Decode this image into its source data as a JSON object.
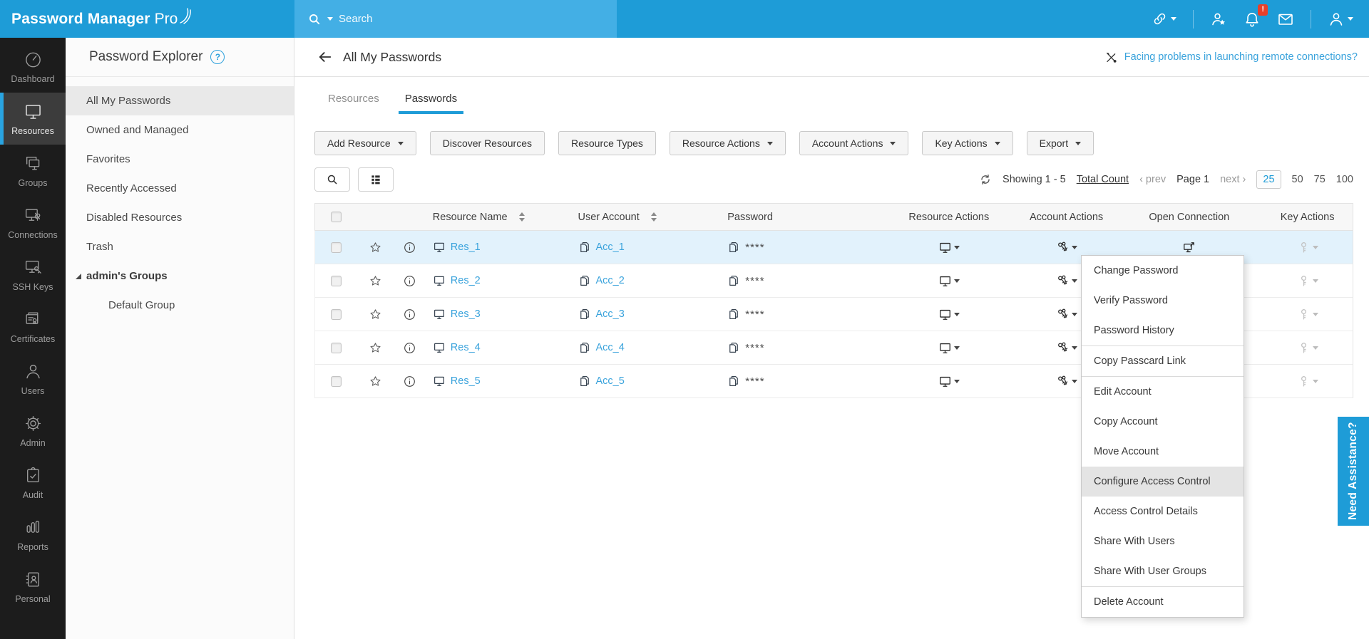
{
  "brand": {
    "name_bold": "Password Manager",
    "name_light": "Pro"
  },
  "topbar": {
    "search_placeholder": "Search",
    "badge": "!",
    "icons": [
      "connection-link-icon",
      "user-star-icon",
      "notification-bell-icon",
      "mail-icon",
      "profile-icon"
    ]
  },
  "nav": {
    "items": [
      {
        "label": "Dashboard",
        "icon": "dashboard-icon",
        "active": false
      },
      {
        "label": "Resources",
        "icon": "resources-icon",
        "active": true
      },
      {
        "label": "Groups",
        "icon": "groups-icon",
        "active": false
      },
      {
        "label": "Connections",
        "icon": "connections-icon",
        "active": false
      },
      {
        "label": "SSH Keys",
        "icon": "ssh-keys-icon",
        "active": false
      },
      {
        "label": "Certificates",
        "icon": "certificates-icon",
        "active": false
      },
      {
        "label": "Users",
        "icon": "users-icon",
        "active": false
      },
      {
        "label": "Admin",
        "icon": "admin-gear-icon",
        "active": false
      },
      {
        "label": "Audit",
        "icon": "audit-icon",
        "active": false
      },
      {
        "label": "Reports",
        "icon": "reports-icon",
        "active": false
      },
      {
        "label": "Personal",
        "icon": "personal-icon",
        "active": false
      }
    ]
  },
  "explorer": {
    "title": "Password Explorer",
    "help_icon": "help-icon",
    "items": [
      {
        "label": "All My Passwords",
        "active": true
      },
      {
        "label": "Owned and Managed",
        "active": false
      },
      {
        "label": "Favorites",
        "active": false
      },
      {
        "label": "Recently Accessed",
        "active": false
      },
      {
        "label": "Disabled Resources",
        "active": false
      },
      {
        "label": "Trash",
        "active": false
      }
    ],
    "tree": [
      {
        "label": "admin's Groups",
        "expanded": true
      },
      {
        "label": "Default Group",
        "child": true
      }
    ]
  },
  "page": {
    "title": "All My Passwords",
    "help_link": "Facing problems in launching remote connections?"
  },
  "tabs": [
    {
      "label": "Resources",
      "active": false
    },
    {
      "label": "Passwords",
      "active": true
    }
  ],
  "toolbar": [
    {
      "label": "Add Resource",
      "dropdown": true
    },
    {
      "label": "Discover Resources",
      "dropdown": false
    },
    {
      "label": "Resource Types",
      "dropdown": false
    },
    {
      "label": "Resource Actions",
      "dropdown": true
    },
    {
      "label": "Account Actions",
      "dropdown": true
    },
    {
      "label": "Key Actions",
      "dropdown": true
    },
    {
      "label": "Export",
      "dropdown": true
    }
  ],
  "view_icons": [
    "search-icon",
    "list-view-icon"
  ],
  "pagination": {
    "refresh_icon": "refresh-icon",
    "showing": "Showing 1 - 5",
    "total_count": "Total Count",
    "prev": "‹ prev",
    "page": "Page 1",
    "next": "next ›",
    "sizes": [
      "25",
      "50",
      "75",
      "100"
    ],
    "selected_size": "25"
  },
  "table": {
    "columns": [
      "Resource Name",
      "User Account",
      "Password",
      "Resource Actions",
      "Account Actions",
      "Open Connection",
      "Key Actions"
    ],
    "password_mask": "****",
    "rows": [
      {
        "resource": "Res_1",
        "account": "Acc_1",
        "selected": true
      },
      {
        "resource": "Res_2",
        "account": "Acc_2",
        "selected": false
      },
      {
        "resource": "Res_3",
        "account": "Acc_3",
        "selected": false
      },
      {
        "resource": "Res_4",
        "account": "Acc_4",
        "selected": false
      },
      {
        "resource": "Res_5",
        "account": "Acc_5",
        "selected": false
      }
    ]
  },
  "context_menu": {
    "items": [
      {
        "label": "Change Password",
        "highlighted": false
      },
      {
        "label": "Verify Password",
        "highlighted": false
      },
      {
        "label": "Password History",
        "highlighted": false,
        "divider_after": true
      },
      {
        "label": "Copy Passcard Link",
        "highlighted": false,
        "divider_after": true
      },
      {
        "label": "Edit Account",
        "highlighted": false
      },
      {
        "label": "Copy Account",
        "highlighted": false
      },
      {
        "label": "Move Account",
        "highlighted": false
      },
      {
        "label": "Configure Access Control",
        "highlighted": true
      },
      {
        "label": "Access Control Details",
        "highlighted": false
      },
      {
        "label": "Share With Users",
        "highlighted": false
      },
      {
        "label": "Share With User Groups",
        "highlighted": false,
        "divider_after": true
      },
      {
        "label": "Delete Account",
        "highlighted": false
      }
    ]
  },
  "assistance_tab": "Need Assistance?",
  "colors": {
    "header_blue": "#1e9cd7",
    "search_strip_blue": "#43afe5",
    "link_blue": "#3aa3dc",
    "badge_red": "#e8402a",
    "row_highlight": "#e2f2fc",
    "rail_dark": "#1c1c1c",
    "menu_highlight": "#e4e4e4"
  }
}
